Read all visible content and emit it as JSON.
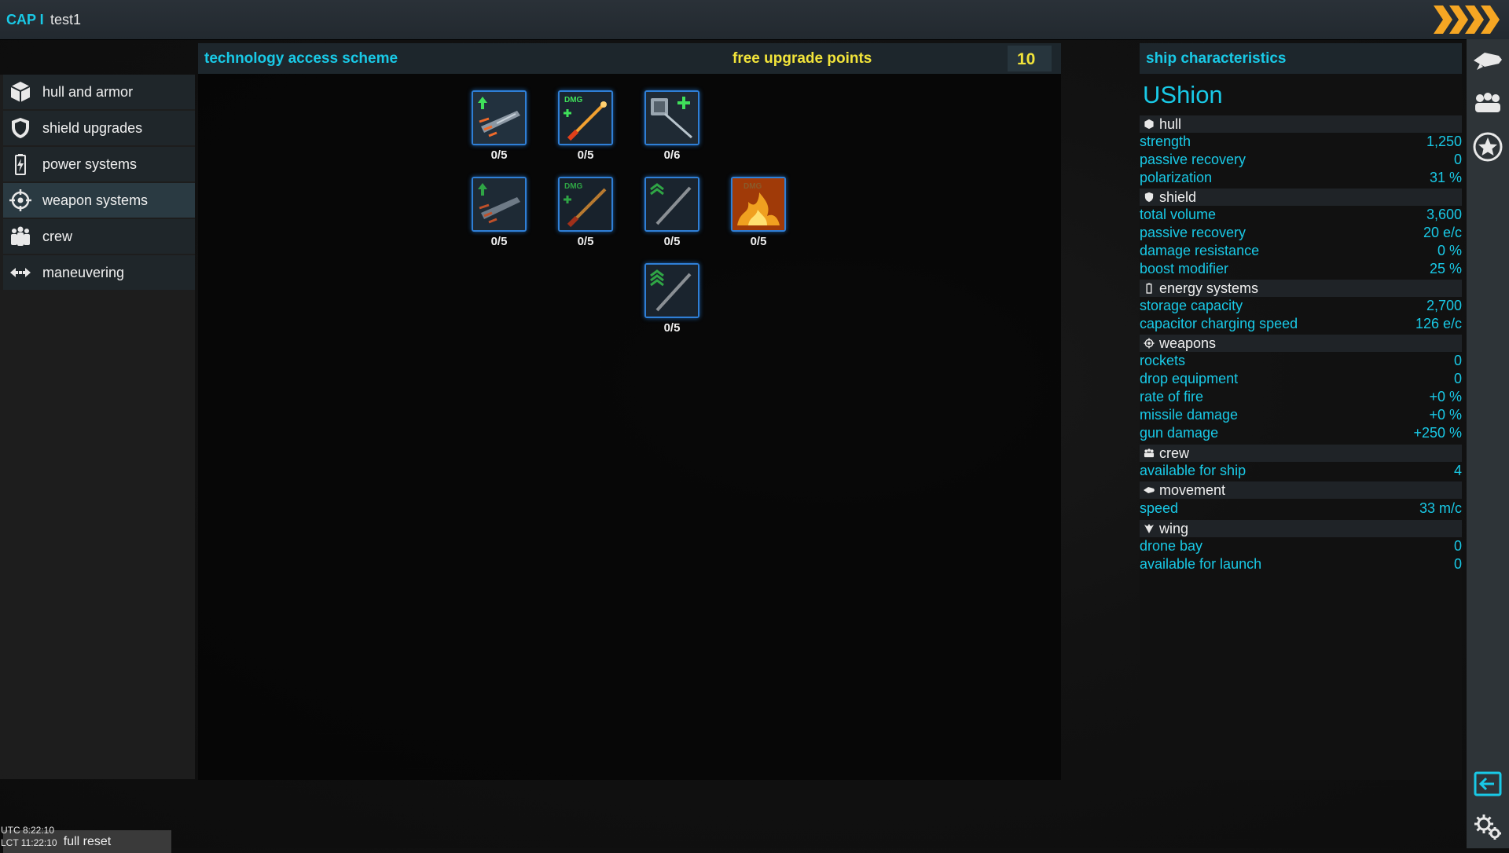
{
  "topbar": {
    "cap": "CAP I",
    "player": "test1"
  },
  "nav": {
    "items": [
      {
        "label": "hull and armor",
        "icon": "cube-icon"
      },
      {
        "label": "shield upgrades",
        "icon": "shield-icon"
      },
      {
        "label": "power systems",
        "icon": "battery-icon"
      },
      {
        "label": "weapon systems",
        "icon": "crosshair-icon",
        "active": true
      },
      {
        "label": "crew",
        "icon": "crew-icon"
      },
      {
        "label": "maneuvering",
        "icon": "arrows-icon"
      }
    ],
    "reset": "full reset"
  },
  "tech": {
    "title": "technology access scheme",
    "free_label": "free upgrade points",
    "free_points": "10",
    "nodes": [
      {
        "label": "0/5",
        "icon": "rate-of-fire-upgrade-icon",
        "level": 0,
        "max": 5
      },
      {
        "label": "0/5",
        "icon": "missile-damage-upgrade-icon",
        "level": 0,
        "max": 5
      },
      {
        "label": "0/6",
        "icon": "launcher-upgrade-icon",
        "level": 0,
        "max": 6
      },
      {
        "label": "0/5",
        "icon": "rate-of-fire-upgrade-icon",
        "level": 0,
        "max": 5
      },
      {
        "label": "0/5",
        "icon": "missile-damage-upgrade-icon",
        "level": 0,
        "max": 5
      },
      {
        "label": "0/5",
        "icon": "gun-damage-rank-icon",
        "level": 0,
        "max": 5
      },
      {
        "label": "0/5",
        "icon": "fire-damage-icon",
        "level": 0,
        "max": 5
      },
      {
        "label": "0/5",
        "icon": "gun-damage-rank-icon",
        "level": 0,
        "max": 5
      }
    ],
    "dmg_text": "DMG"
  },
  "ship": {
    "title": "ship characteristics",
    "name": "UShion",
    "sections": {
      "hull": {
        "title": "hull",
        "rows": [
          {
            "label": "strength",
            "value": "1,250"
          },
          {
            "label": "passive recovery",
            "value": "0"
          },
          {
            "label": "polarization",
            "value": "31 %"
          }
        ]
      },
      "shield": {
        "title": "shield",
        "rows": [
          {
            "label": "total volume",
            "value": "3,600"
          },
          {
            "label": "passive recovery",
            "value": "20 e/c"
          },
          {
            "label": "damage resistance",
            "value": "0 %"
          },
          {
            "label": "boost modifier",
            "value": "25 %"
          }
        ]
      },
      "energy": {
        "title": "energy systems",
        "rows": [
          {
            "label": "storage capacity",
            "value": "2,700"
          },
          {
            "label": "capacitor charging speed",
            "value": "126 e/c"
          }
        ]
      },
      "weapons": {
        "title": "weapons",
        "rows": [
          {
            "label": "rockets",
            "value": "0"
          },
          {
            "label": "drop equipment",
            "value": "0"
          },
          {
            "label": "rate of fire",
            "value": "+0 %"
          },
          {
            "label": "missile damage",
            "value": "+0 %"
          },
          {
            "label": "gun damage",
            "value": "+250 %"
          }
        ]
      },
      "crew": {
        "title": "crew",
        "rows": [
          {
            "label": "available for ship",
            "value": "4"
          }
        ]
      },
      "movement": {
        "title": "movement",
        "rows": [
          {
            "label": "speed",
            "value": "33 m/c"
          }
        ]
      },
      "wing": {
        "title": "wing",
        "rows": [
          {
            "label": "drone bay",
            "value": "0"
          },
          {
            "label": "available for launch",
            "value": "0"
          }
        ]
      }
    }
  },
  "clock": {
    "utc": "UTC 8:22:10",
    "lct": "LCT 11:22:10"
  },
  "colors": {
    "accent": "#19c9e6",
    "points": "#f2e43a",
    "chevrons": "#f5a623"
  }
}
